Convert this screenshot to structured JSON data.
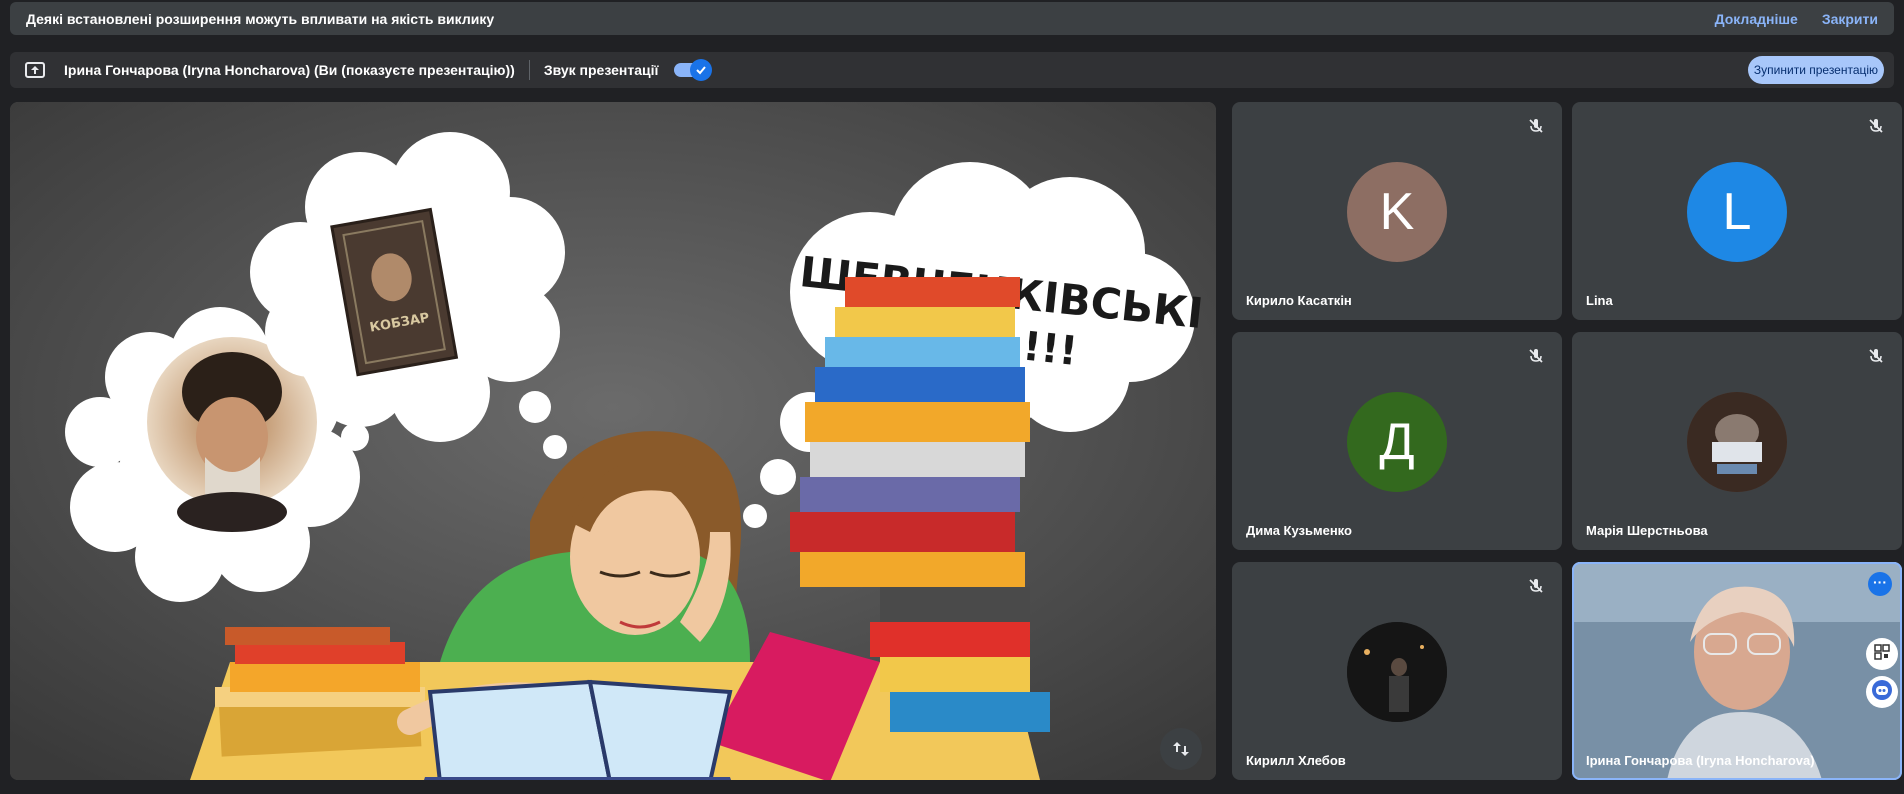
{
  "banner": {
    "text": "Деякі встановлені розширення можуть впливати на якість виклику",
    "details_link": "Докладніше",
    "close_link": "Закрити"
  },
  "presentation_bar": {
    "presenter": "Ірина Гончарова (Iryna Honcharova) (Ви (показуєте презентацію))",
    "audio_label": "Звук презентації",
    "audio_enabled": true,
    "stop_button": "Зупинити презентацію"
  },
  "slide": {
    "title_line1": "ШЕВЧЕНКІВСЬКІ",
    "title_line2": "ДНІ !!!",
    "book_title": "КОБЗАР"
  },
  "participants": [
    {
      "name": "Кирило Касаткін",
      "initial": "K",
      "avatar_color": "#8d6e63",
      "muted": true
    },
    {
      "name": "Lina",
      "initial": "L",
      "avatar_color": "#1e88e5",
      "muted": true
    },
    {
      "name": "Дима Кузьменко",
      "initial": "Д",
      "avatar_color": "#33691e",
      "muted": true
    },
    {
      "name": "Марія Шерстньова",
      "initial": "",
      "avatar_color": "#5d4037",
      "muted": true
    },
    {
      "name": "Кирилл Хлебов",
      "initial": "",
      "avatar_color": "#1c1c1c",
      "muted": true
    },
    {
      "name": "Ірина Гончарова (Iryna Honcharova)",
      "initial": "",
      "avatar_color": "#6b7d90",
      "muted": false
    }
  ],
  "colors": {
    "accent": "#8ab4f8",
    "background": "#202124",
    "tile": "#3c4043"
  }
}
